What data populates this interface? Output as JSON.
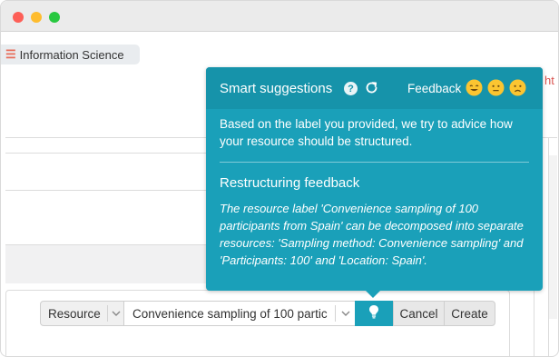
{
  "window": {
    "controls": [
      "close",
      "minimize",
      "maximize"
    ]
  },
  "breadcrumb": {
    "icon": "hamburger-menu-icon",
    "label": "Information Science"
  },
  "url_fragment": "ht",
  "form": {
    "resource_select": {
      "value": "Resource",
      "icon": "chevron-down-icon"
    },
    "label_input": {
      "value": "Convenience sampling of 100 partici",
      "icon": "chevron-down-icon"
    },
    "suggestion_button": {
      "icon": "lightbulb-icon"
    },
    "cancel_label": "Cancel",
    "create_label": "Create"
  },
  "smart_suggestions": {
    "title": "Smart suggestions",
    "help_glyph": "?",
    "help_icon": "help-icon",
    "refresh_icon": "refresh-icon",
    "feedback_label": "Feedback",
    "feedback_options": [
      "happy-face-icon",
      "neutral-face-icon",
      "sad-face-icon"
    ],
    "intro": "Based on the label you provided, we try to advice how your resource should be structured.",
    "subtitle": "Restructuring feedback",
    "body": "The resource label 'Convenience sampling of 100 participants from Spain' can be decomposed into separate resources: 'Sampling method: Convenience sampling' and 'Participants: 100' and 'Location: Spain'."
  },
  "colors": {
    "popover": "#1aa0b9",
    "popover_header": "#1693aa",
    "accent_red": "#e86c5a"
  }
}
